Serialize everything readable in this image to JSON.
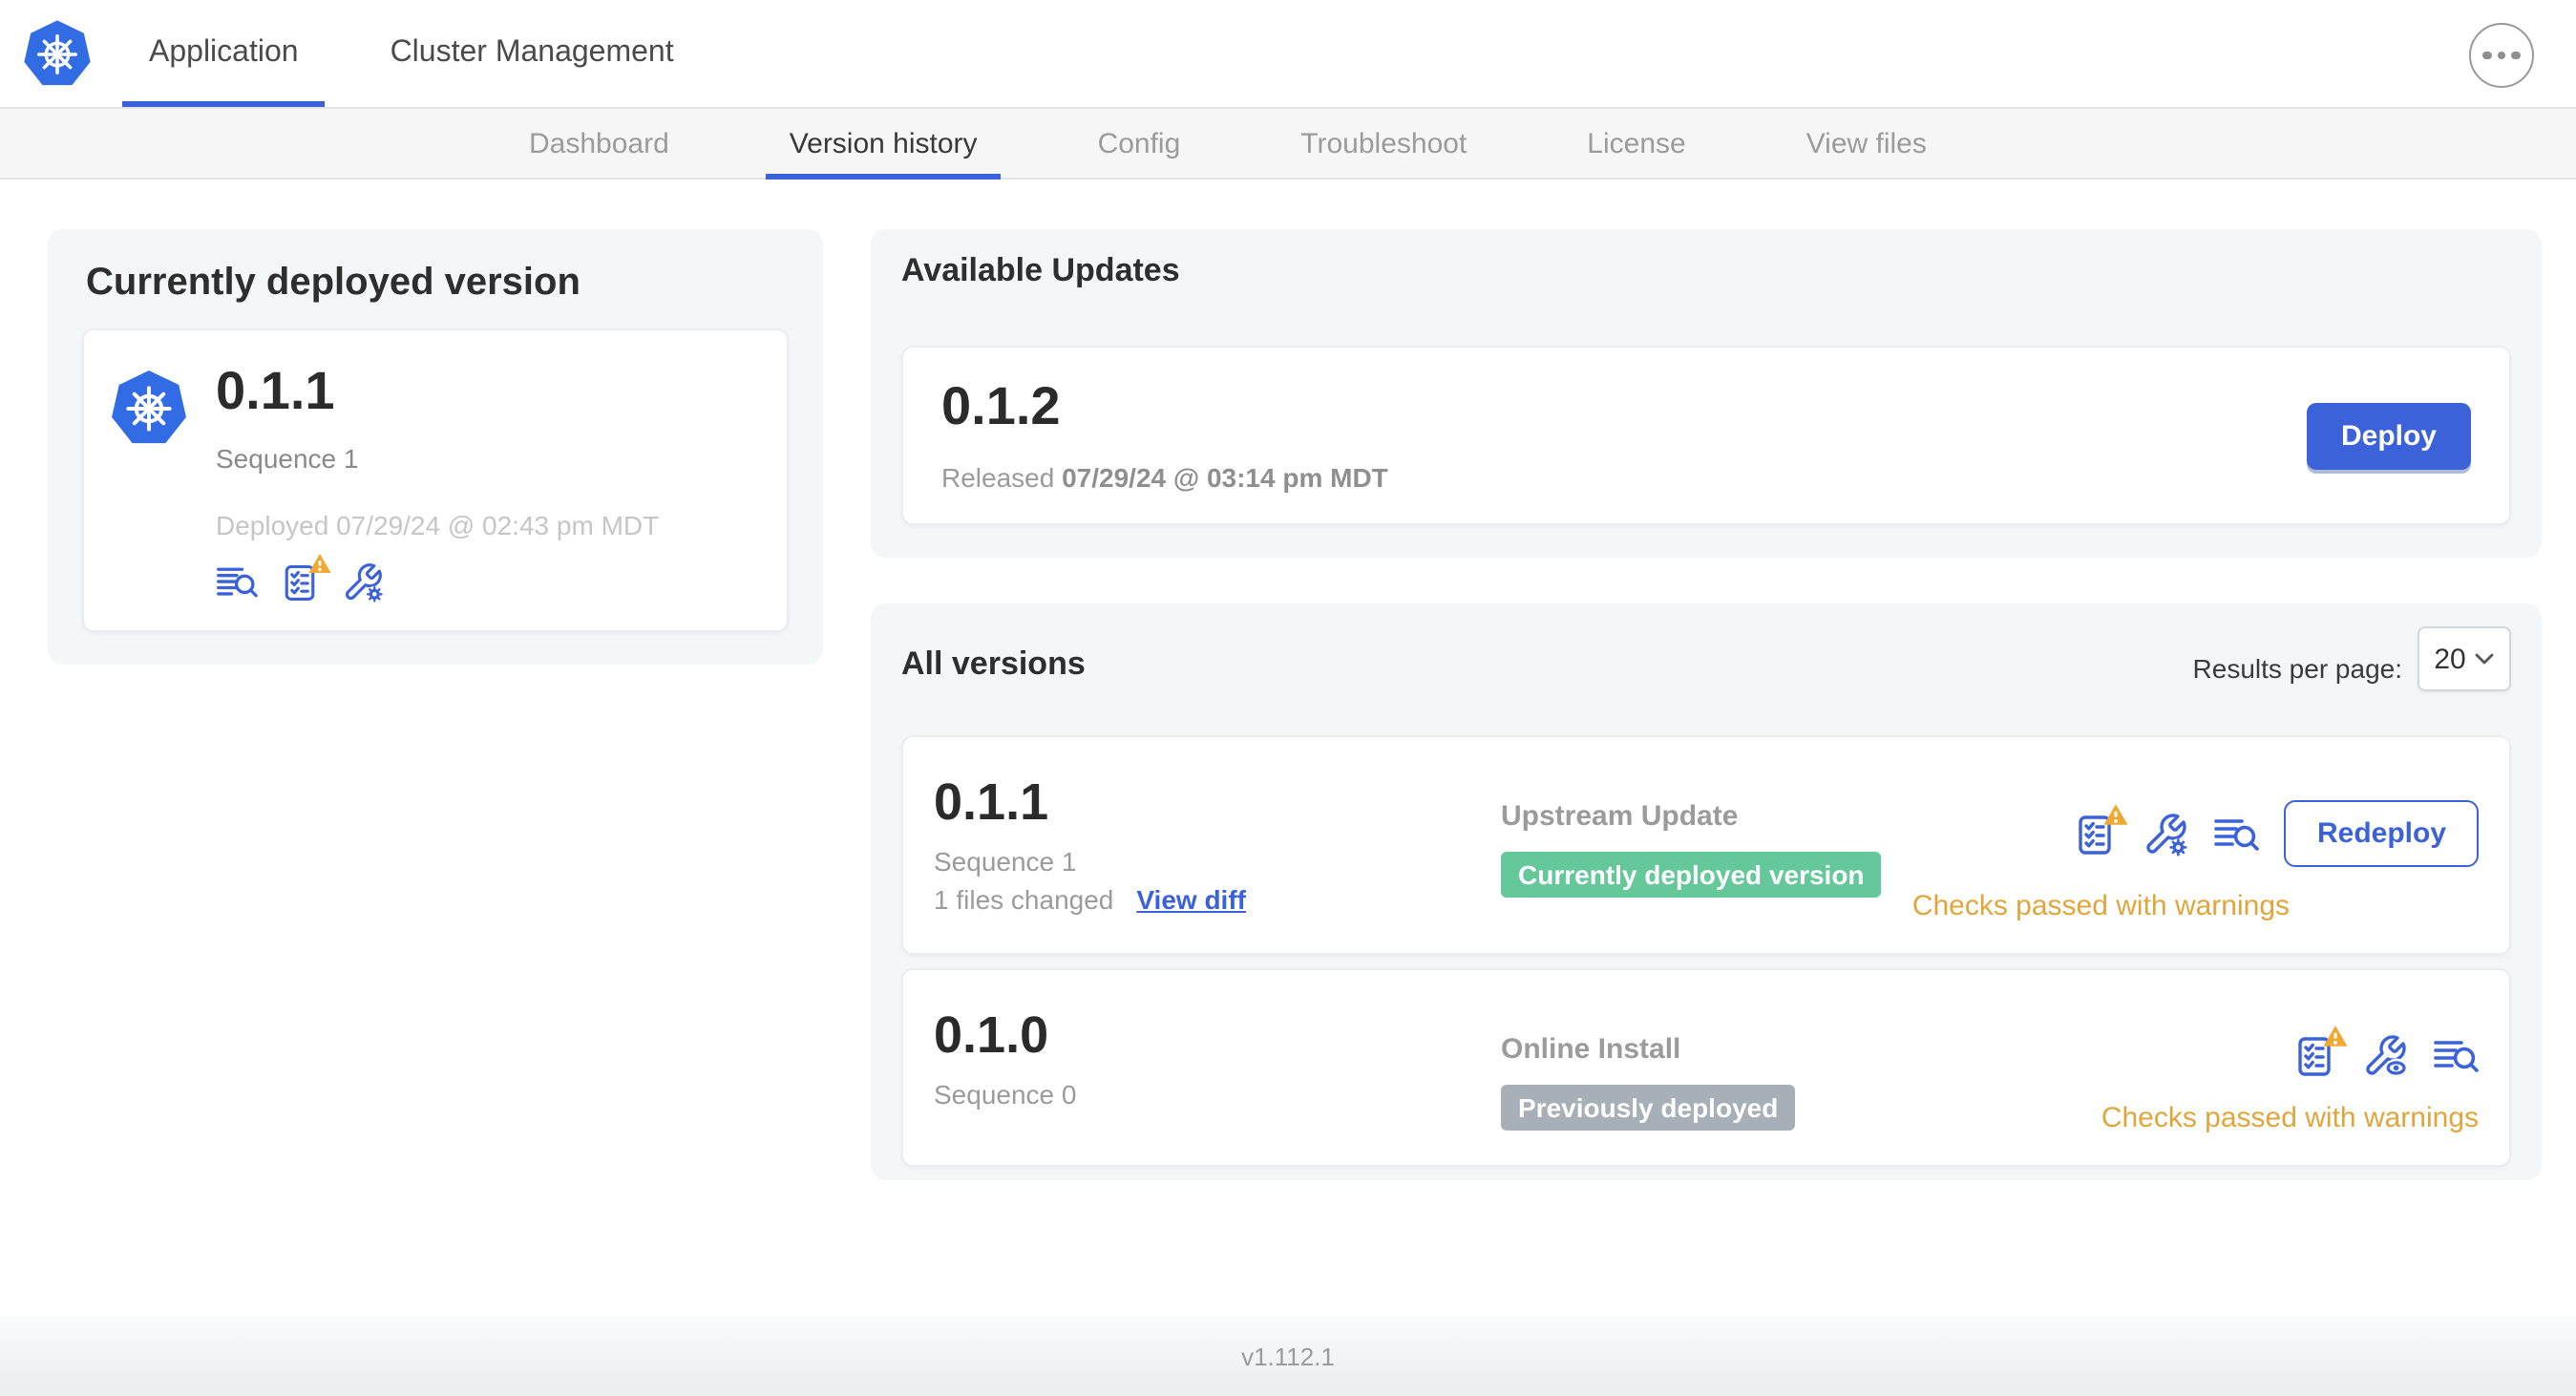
{
  "header": {
    "tabs": [
      {
        "label": "Application"
      },
      {
        "label": "Cluster Management"
      }
    ]
  },
  "subnav": {
    "tabs": [
      "Dashboard",
      "Version history",
      "Config",
      "Troubleshoot",
      "License",
      "View files"
    ],
    "active": "Version history"
  },
  "current_version": {
    "title": "Currently deployed version",
    "version": "0.1.1",
    "sequence": "Sequence 1",
    "deployed": "Deployed 07/29/24 @ 02:43 pm MDT"
  },
  "available_updates": {
    "title": "Available Updates",
    "version": "0.1.2",
    "released_prefix": "Released",
    "released_date": "07/29/24 @ 03:14 pm MDT",
    "deploy_label": "Deploy"
  },
  "all_versions": {
    "title": "All versions",
    "results_per_page_label": "Results per page:",
    "results_per_page_value": "20",
    "rows": [
      {
        "version": "0.1.1",
        "sequence": "Sequence 1",
        "files_changed": "1 files changed",
        "view_diff_label": "View diff",
        "source": "Upstream Update",
        "badge": "Currently deployed version",
        "badge_color": "#65c89b",
        "status": "Checks passed with warnings",
        "redeploy_label": "Redeploy"
      },
      {
        "version": "0.1.0",
        "sequence": "Sequence 0",
        "source": "Online Install",
        "badge": "Previously deployed",
        "badge_color": "#a6b0b6",
        "status": "Checks passed with warnings"
      }
    ]
  },
  "footer": {
    "version": "v1.112.1"
  },
  "colors": {
    "accent_blue": "#3c62d9",
    "kubernetes_blue": "#326ce5",
    "green_badge": "#65c89b",
    "gray_badge": "#a6b0b6",
    "warning_text": "#e0a63b",
    "warning_triangle": "#efa832",
    "card_gray": "#f5f6f8"
  },
  "icons": {
    "app_logo": "kubernetes-wheel",
    "menu": "ellipsis-circle",
    "logs": "log-lines-magnifier",
    "preflight": "checklist",
    "preflight_warning": "warning-triangle",
    "config_edit": "wrench-gear",
    "config_view": "wrench-eye",
    "select_chevron": "chevron-down"
  }
}
